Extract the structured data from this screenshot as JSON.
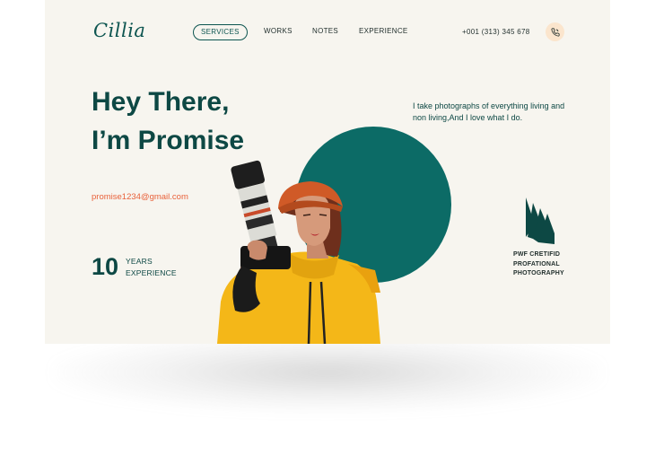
{
  "brand": {
    "logo": "Cillia"
  },
  "nav": {
    "items": [
      {
        "label": "SERVICES",
        "active": true
      },
      {
        "label": "WORKS",
        "active": false
      },
      {
        "label": "NOTES",
        "active": false
      },
      {
        "label": "EXPERIENCE",
        "active": false
      }
    ],
    "phone": "+001 (313) 345 678",
    "phone_icon": "phone-icon"
  },
  "hero": {
    "headline_line1": "Hey There,",
    "headline_line2": "I’m Promise",
    "tagline": "I take photographs of everything living and non living,And I love what I do.",
    "email": "promise1234@gmail.com",
    "experience": {
      "number": "10",
      "line1": "YEARS",
      "line2": "EXPERIENCE"
    },
    "badge": {
      "line1": "PWF CRETIFID",
      "line2": "PROFATIONAL",
      "line3": "PHOTOGRAPHY",
      "icon": "pwf-logo-icon"
    },
    "photo": "photographer-with-camera"
  },
  "colors": {
    "accent": "#0c6b66",
    "dark_text": "#0d4844",
    "email": "#e9623b",
    "background": "#f7f5ef",
    "phone_button": "#fbe5cd",
    "hoodie": "#f4b718"
  }
}
